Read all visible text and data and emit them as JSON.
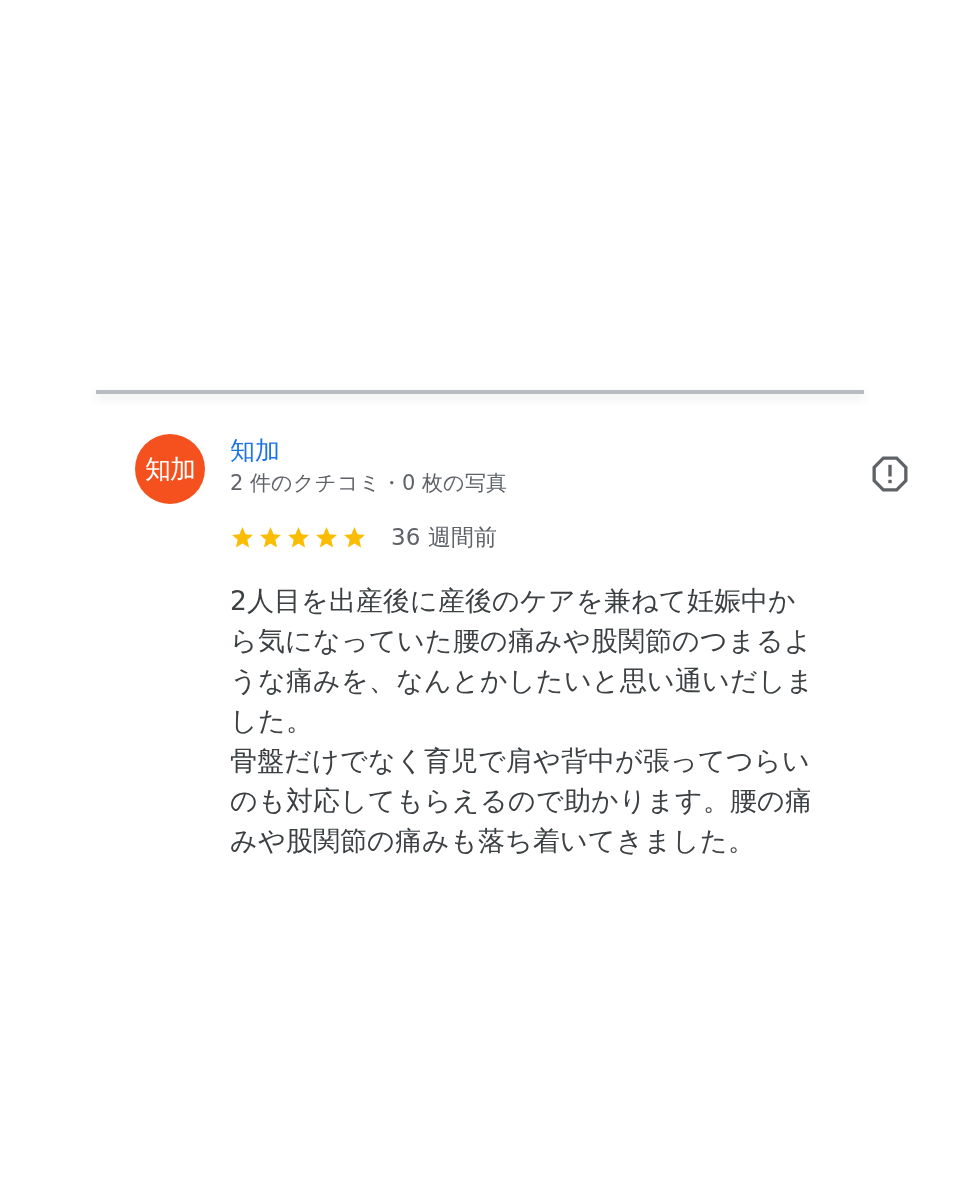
{
  "review": {
    "avatar": {
      "initials": "知加",
      "color": "#f4511e"
    },
    "author": "知加",
    "stats": "2 件のクチコミ・0 枚の写真",
    "stars": 5,
    "time": "36 週間前",
    "body": [
      "2人目を出産後に産後のケアを兼ねて妊娠中から気になっていた腰の痛みや股関節のつまるような痛みを、なんとかしたいと思い通いだしました。",
      "骨盤だけでなく育児で肩や背中が張ってつらいのも対応してもらえるので助かります。腰の痛みや股関節の痛みも落ち着いてきました。"
    ]
  }
}
